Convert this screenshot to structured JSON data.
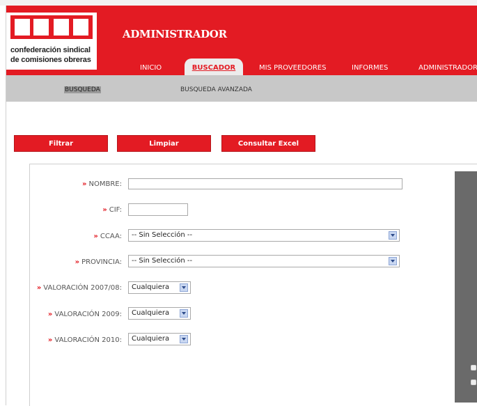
{
  "header": {
    "brand_logo_text": "CCOO",
    "logo_line1": "confederación sindical",
    "logo_line2": "de comisiones obreras",
    "title": "ADMINISTRADOR",
    "bg_color": "#e31b23"
  },
  "nav": {
    "items": [
      "INICIO",
      "BUSCADOR",
      "MIS PROVEEDORES",
      "INFORMES",
      "ADMINISTRADOR"
    ],
    "active": "BUSCADOR"
  },
  "subnav": {
    "items": [
      "BUSQUEDA",
      "BUSQUEDA AVANZADA"
    ],
    "active": "BUSQUEDA"
  },
  "actions": {
    "filter_label": "Filtrar",
    "clear_label": "Limpiar",
    "excel_label": "Consultar Excel"
  },
  "form": {
    "bullet": "»",
    "nombre_label": "NOMBRE:",
    "nombre_value": "",
    "cif_label": "CIF:",
    "cif_value": "",
    "ccaa_label": "CCAA:",
    "ccaa_value": "-- Sin Selección --",
    "provincia_label": "PROVINCIA:",
    "provincia_value": "-- Sin Selección --",
    "val0708_label": "VALORACIÓN 2007/08:",
    "val0708_value": "Cualquiera",
    "val2009_label": "VALORACIÓN 2009:",
    "val2009_value": "Cualquiera",
    "val2010_label": "VALORACIÓN 2010:",
    "val2010_value": "Cualquiera"
  }
}
